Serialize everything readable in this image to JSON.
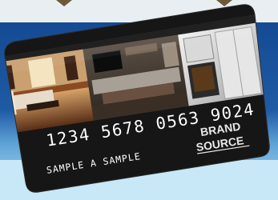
{
  "card": {
    "number": "1234 5678 0563 9024",
    "holder_name": "SAMPLE A SAMPLE",
    "brand_line1": "BRAND",
    "brand_line2": "SOURCE",
    "card_color": "#161616"
  },
  "background": {
    "top_color": "#1f5aa5",
    "bottom_color": "#bfe2f4"
  }
}
